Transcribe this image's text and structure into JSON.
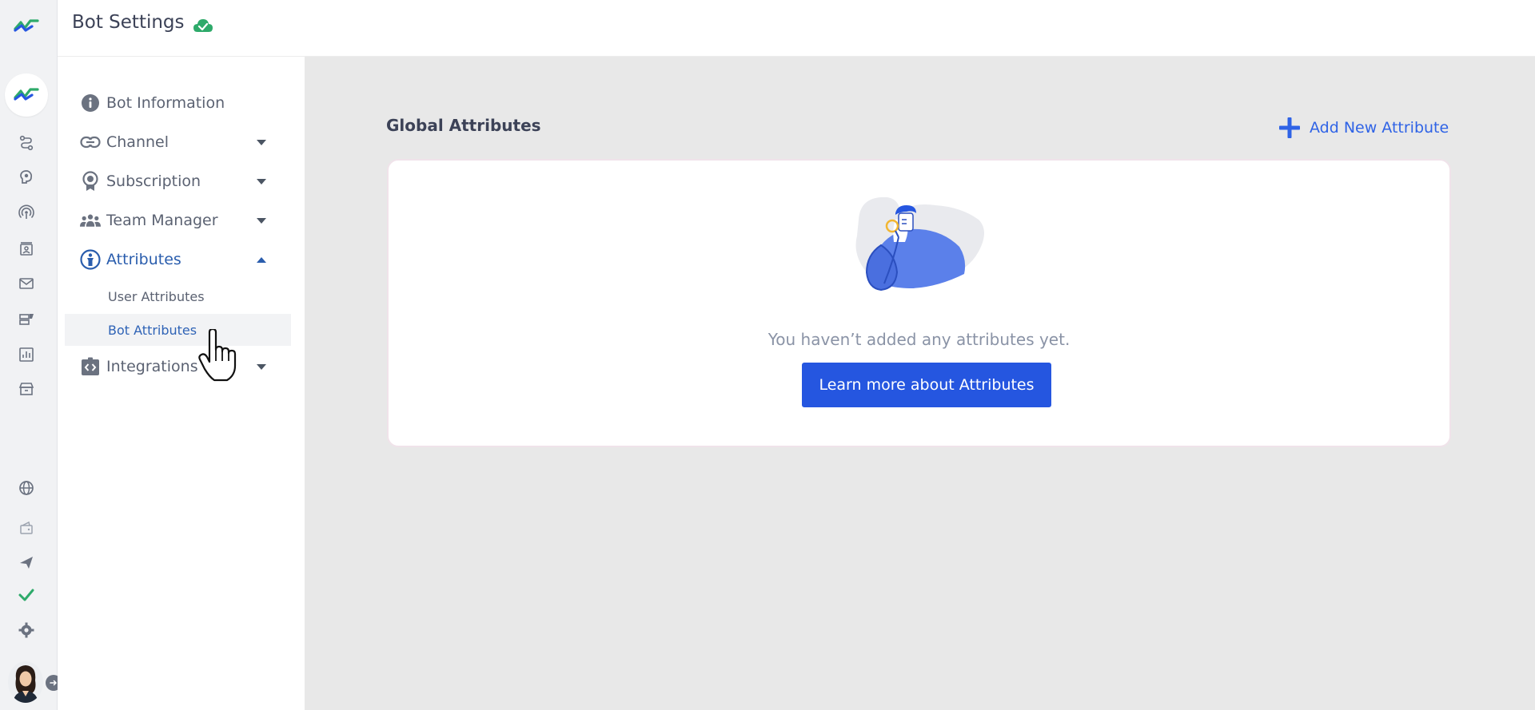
{
  "header": {
    "title": "Bot Settings",
    "status_icon": "cloud-check-icon",
    "status_color": "#2eaa6a"
  },
  "rail": {
    "icons": [
      "logo-icon",
      "bot-avatar-icon",
      "flow-icon",
      "brain-icon",
      "broadcast-icon",
      "contacts-icon",
      "mail-icon",
      "templates-icon",
      "analytics-icon",
      "store-icon",
      "globe-icon",
      "wallet-icon",
      "send-icon",
      "check-icon",
      "gear-icon",
      "user-avatar",
      "expand-icon"
    ],
    "check_color": "#2eaa6a"
  },
  "sidebar": {
    "items": [
      {
        "label": "Bot Information",
        "icon": "info-icon"
      },
      {
        "label": "Channel",
        "icon": "link-icon"
      },
      {
        "label": "Subscription",
        "icon": "badge-icon"
      },
      {
        "label": "Team Manager",
        "icon": "team-icon"
      },
      {
        "label": "Attributes",
        "icon": "attributes-icon",
        "expanded": true
      },
      {
        "label": "Integrations",
        "icon": "integrations-icon"
      }
    ],
    "sub_items": [
      {
        "label": "User Attributes"
      },
      {
        "label": "Bot Attributes",
        "selected": true
      }
    ]
  },
  "main": {
    "section_title": "Global Attributes",
    "add_button_label": "Add New Attribute",
    "empty_message": "You haven’t added any attributes yet.",
    "learn_button_label": "Learn more about Attributes"
  },
  "colors": {
    "accent": "#2556e0",
    "link": "#2f63e6",
    "active_nav": "#2a5dad"
  }
}
